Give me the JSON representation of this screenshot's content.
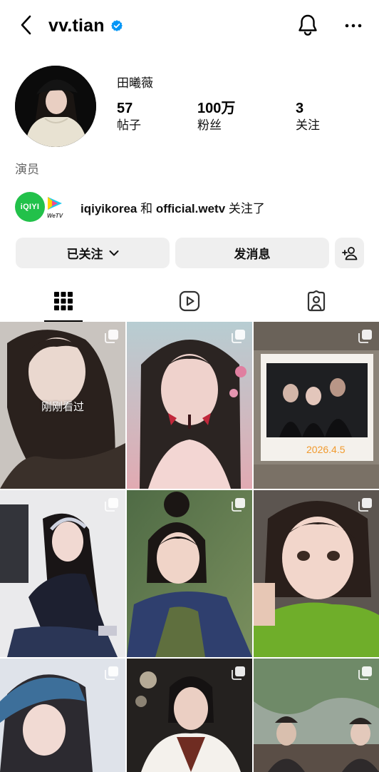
{
  "header": {
    "username": "vv.tian",
    "icons": {
      "back": "chevron-left-icon",
      "verified": "verified-badge-icon",
      "notifications": "bell-icon",
      "more": "more-horizontal-icon"
    }
  },
  "profile": {
    "display_name": "田曦薇",
    "stats": {
      "posts": {
        "value": "57",
        "label": "帖子"
      },
      "followers": {
        "value": "100万",
        "label": "粉丝"
      },
      "following": {
        "value": "3",
        "label": "关注"
      }
    },
    "bio": "演员",
    "followed_by": {
      "account_1": "iqiyikorea",
      "connector": "和",
      "account_2": "official.wetv",
      "suffix": "关注了",
      "avatar_1_text": "iQIYI",
      "avatar_2_text": "WeTV"
    }
  },
  "actions": {
    "following_label": "已关注",
    "message_label": "发消息",
    "add_user_icon": "add-user-icon"
  },
  "tabs": [
    {
      "name": "posts-grid",
      "icon": "grid-icon",
      "active": true
    },
    {
      "name": "reels",
      "icon": "reels-icon",
      "active": false
    },
    {
      "name": "tagged",
      "icon": "tagged-user-icon",
      "active": false
    }
  ],
  "grid": {
    "tile_1_overlay": "刚刚看过",
    "tile_3_date_stamp": "2026.4.5"
  },
  "colors": {
    "accent_verified": "#0095f6",
    "button_bg": "#efefef",
    "iqiyi_green": "#22c14a",
    "muted_text": "#666666"
  }
}
